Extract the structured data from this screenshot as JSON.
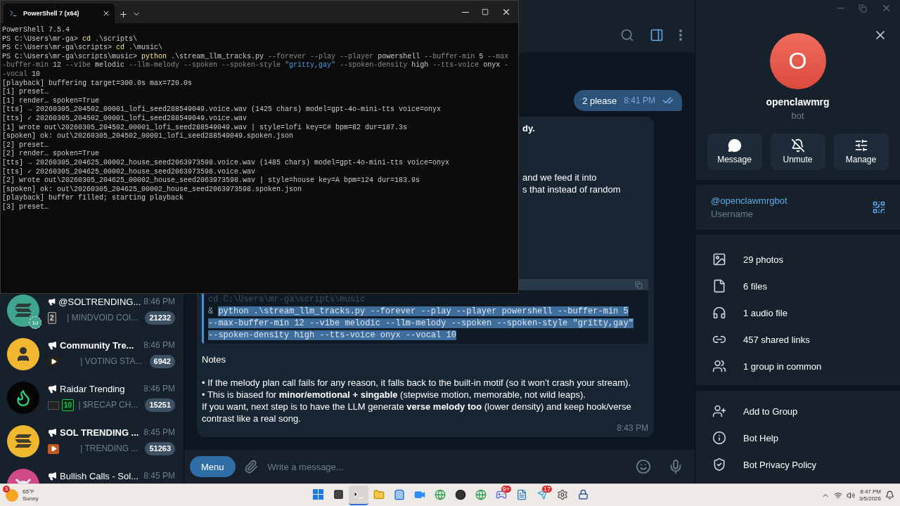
{
  "terminal": {
    "tab_title": "PowerShell 7 (x64)",
    "lines": [
      {
        "text": "PowerShell 7.5.4"
      },
      {
        "segments": [
          {
            "text": "PS C:\\Users\\mr-ga> ",
            "kind": "text"
          },
          {
            "text": "cd",
            "kind": "cmd"
          },
          {
            "text": " .\\scripts\\",
            "kind": "text"
          }
        ]
      },
      {
        "segments": [
          {
            "text": "PS C:\\Users\\mr-ga\\scripts> ",
            "kind": "text"
          },
          {
            "text": "cd",
            "kind": "cmd"
          },
          {
            "text": " .\\music\\",
            "kind": "text"
          }
        ]
      },
      {
        "segments": [
          {
            "text": "PS C:\\Users\\mr-ga\\scripts\\music> ",
            "kind": "text"
          },
          {
            "text": "python",
            "kind": "cmd"
          },
          {
            "text": " .\\stream_llm_tracks.py ",
            "kind": "text"
          },
          {
            "text": "--forever --play --player",
            "kind": "param"
          },
          {
            "text": " powershell ",
            "kind": "text"
          },
          {
            "text": "--buffer-min",
            "kind": "param"
          },
          {
            "text": " 5 ",
            "kind": "text"
          },
          {
            "text": "--max",
            "kind": "param"
          }
        ]
      },
      {
        "segments": [
          {
            "text": "-buffer-min",
            "kind": "param"
          },
          {
            "text": " 12 ",
            "kind": "text"
          },
          {
            "text": "--vibe",
            "kind": "param"
          },
          {
            "text": " melodic ",
            "kind": "text"
          },
          {
            "text": "--llm-melody --spoken --spoken-style ",
            "kind": "param"
          },
          {
            "text": "\"gritty,gay\" ",
            "kind": "str"
          },
          {
            "text": "--spoken-density",
            "kind": "param"
          },
          {
            "text": " high ",
            "kind": "text"
          },
          {
            "text": "--tts-voice",
            "kind": "param"
          },
          {
            "text": " onyx ",
            "kind": "text"
          },
          {
            "text": "-",
            "kind": "param"
          }
        ]
      },
      {
        "segments": [
          {
            "text": "-vocal",
            "kind": "param"
          },
          {
            "text": " 10",
            "kind": "text"
          }
        ]
      },
      {
        "text": "[playback] buffering target=300.0s max=720.0s"
      },
      {
        "text": "[1] preset…"
      },
      {
        "text": "[1] render… spoken=True"
      },
      {
        "text": "[tts] → 20260305_204502_00001_lofi_seed288549049.voice.wav (1425 chars) model=gpt-4o-mini-tts voice=onyx"
      },
      {
        "text": "[tts] ✓ 20260305_204502_00001_lofi_seed288549049.voice.wav"
      },
      {
        "text": "[1] wrote out\\20260305_204502_00001_lofi_seed288549049.wav | style=lofi key=C# bpm=82 dur=187.3s"
      },
      {
        "text": "[spoken] ok: out\\20260305_204502_00001_lofi_seed288549049.spoken.json"
      },
      {
        "text": "[2] preset…"
      },
      {
        "text": "[2] render… spoken=True"
      },
      {
        "text": "[tts] → 20260305_204625_00002_house_seed2063973598.voice.wav (1485 chars) model=gpt-4o-mini-tts voice=onyx"
      },
      {
        "text": "[tts] ✓ 20260305_204625_00002_house_seed2063973598.voice.wav"
      },
      {
        "text": "[2] wrote out\\20260305_204625_00002_house_seed2063973598.wav | style=house key=A bpm=124 dur=183.9s"
      },
      {
        "text": "[spoken] ok: out\\20260305_204625_00002_house_seed2063973598.spoken.json"
      },
      {
        "text": "[playback] buffer filled; starting playback"
      },
      {
        "text": "[3] preset…"
      }
    ]
  },
  "chat_list": [
    {
      "name": "@SOLTRENDING...",
      "bold": false,
      "time": "8:46 PM",
      "kind": "stripes",
      "color": "#3fa58f",
      "badge": "1d",
      "preview_icons": [
        {
          "kind": "keycap",
          "text": "2"
        }
      ],
      "preview": "| MINDVOID COI...",
      "count": "21232"
    },
    {
      "name": "Community Tre...",
      "bold": true,
      "time": "8:46 PM",
      "kind": "person",
      "color": "#f2b731",
      "preview_icons": [
        {
          "kind": "play"
        }
      ],
      "preview": "| VOTING STA...",
      "count": "6942"
    },
    {
      "name": "Raidar Trending",
      "bold": false,
      "time": "8:46 PM",
      "kind": "flame",
      "color": "#050505",
      "preview_icons": [
        {
          "kind": "thumbnail"
        },
        {
          "kind": "keycap_green",
          "text": "10"
        }
      ],
      "preview": "| $RECAP CH...",
      "count": "15251"
    },
    {
      "name": "SOL TRENDING ...",
      "bold": true,
      "time": "8:45 PM",
      "kind": "stripes",
      "color": "#f2b731",
      "preview_icons": [
        {
          "kind": "play_orange"
        }
      ],
      "preview": "| TRENDING ...",
      "count": "51263"
    },
    {
      "name": "Bullish Calls - Sol...",
      "bold": false,
      "time": "8:45 PM",
      "kind": "mascot",
      "color": "#d04a86"
    }
  ],
  "messages": [
    {
      "kind": "outgoing",
      "text": "2 please",
      "time": "8:41 PM",
      "read": true
    },
    {
      "kind": "incoming",
      "fragments": [
        {
          "text": "dy.",
          "bold": true
        },
        {
          "text": "and we feed it into",
          "bold": false
        },
        {
          "text": "s that instead of random",
          "bold": false
        }
      ],
      "code": {
        "faded_line": "cd C:\\Users\\mr-ga\\scripts\\music",
        "prefix": "&",
        "selected": true,
        "lines": [
          "python .\\stream_llm_tracks.py --forever --play --player powershell --buffer-min 5",
          "--max-buffer-min 12 --vibe melodic --llm-melody --spoken --spoken-style \"gritty,gay\"",
          "--spoken-density high --tts-voice onyx --vocal 10"
        ]
      },
      "notes_title": "Notes",
      "paragraphs": [
        "• If the melody plan call fails for any reason, it falls back to the built-in motif (so it won’t crash your stream).",
        "• This is biased for **minor/emotional + singable** (stepwise motion, memorable, not wild leaps).",
        "If you want, next step is to have the LLM generate **verse melody too** (lower density) and keep hook/verse contrast like a real song."
      ],
      "time": "8:43 PM"
    }
  ],
  "composer": {
    "menu_label": "Menu",
    "placeholder": "Write a message..."
  },
  "profile": {
    "initial": "O",
    "name": "openclawmrg",
    "subtitle": "bot",
    "actions": [
      {
        "kind": "message",
        "label": "Message"
      },
      {
        "kind": "unmute",
        "label": "Unmute"
      },
      {
        "kind": "manage",
        "label": "Manage"
      }
    ],
    "username": "@openclawmrgbot",
    "username_caption": "Username",
    "media": [
      {
        "kind": "photo",
        "label": "29 photos"
      },
      {
        "kind": "file",
        "label": "6 files"
      },
      {
        "kind": "audio",
        "label": "1 audio file"
      },
      {
        "kind": "link",
        "label": "457 shared links"
      },
      {
        "kind": "group",
        "label": "1 group in common"
      }
    ],
    "bot_actions": [
      {
        "kind": "add",
        "label": "Add to Group"
      },
      {
        "kind": "info",
        "label": "Bot Help"
      },
      {
        "kind": "shield",
        "label": "Bot Privacy Policy"
      }
    ]
  },
  "taskbar": {
    "weather": {
      "badge": "3",
      "temp": "65°F",
      "condition": "Sunny"
    },
    "apps": [
      {
        "kind": "start",
        "selected": false
      },
      {
        "kind": "taskview",
        "selected": false
      },
      {
        "kind": "terminal",
        "selected": true
      },
      {
        "kind": "files",
        "selected": false
      },
      {
        "kind": "store",
        "selected": false
      },
      {
        "kind": "zoom",
        "selected": false
      },
      {
        "kind": "browser",
        "selected": false
      },
      {
        "kind": "recorder",
        "selected": false
      },
      {
        "kind": "browser",
        "selected": false
      },
      {
        "kind": "discord",
        "selected": false,
        "badge": "9+"
      },
      {
        "kind": "notepad",
        "selected": false
      },
      {
        "kind": "telegram",
        "selected": false,
        "badge": "17"
      },
      {
        "kind": "settings",
        "selected": false
      },
      {
        "kind": "vpn",
        "selected": false
      }
    ],
    "time": "8:47 PM",
    "date": "3/5/2026"
  }
}
